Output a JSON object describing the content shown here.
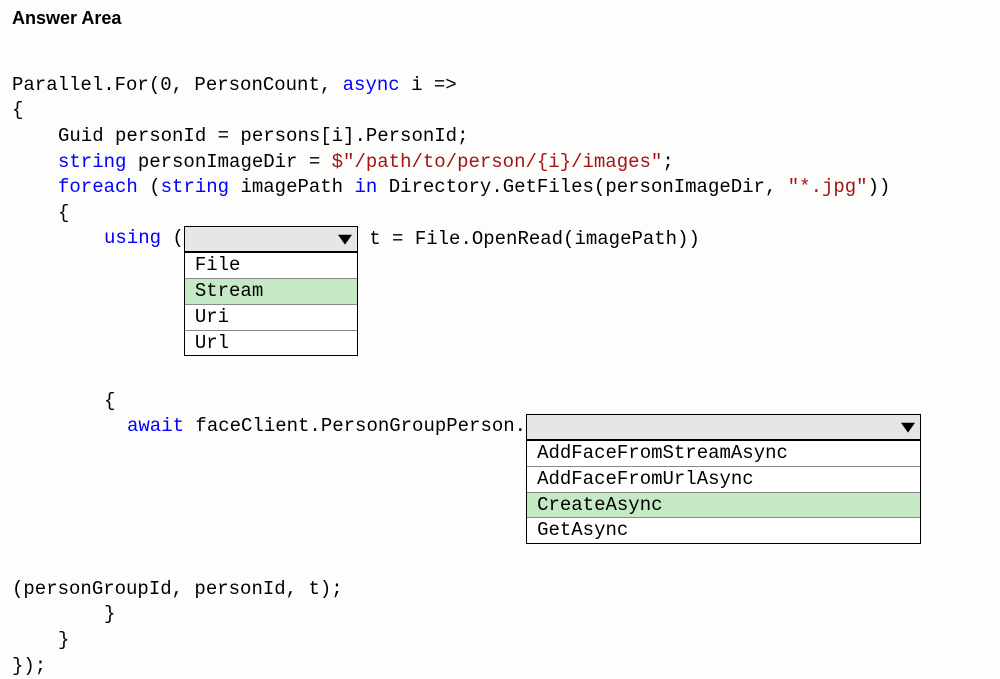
{
  "heading": "Answer Area",
  "code": {
    "line1_a": "Parallel.For(0, PersonCount, ",
    "line1_kw": "async",
    "line1_b": " i =>",
    "line2": "{",
    "line3_a": "Guid personId = persons[i].PersonId;",
    "line4_kw": "string",
    "line4_a": " personImageDir = ",
    "line4_str": "$\"/path/to/person/{i}/images\"",
    "line4_b": ";",
    "line5_kw1": "foreach",
    "line5_a": " (",
    "line5_kw2": "string",
    "line5_b": " imagePath ",
    "line5_kw3": "in",
    "line5_c": " Directory.GetFiles(personImageDir, ",
    "line5_str": "\"*.jpg\"",
    "line5_d": "))",
    "line6": "{",
    "line7_kw": "using",
    "line7_a": " (",
    "line7_after": " t = File.OpenRead(imagePath))",
    "line8": "{",
    "line9_kw": "await",
    "line9_a": " faceClient.PersonGroupPerson.",
    "line10": "(personGroupId, personId, t);",
    "line11": "}",
    "line12": "}",
    "line13": "});"
  },
  "dropdown1": {
    "options": [
      "File",
      "Stream",
      "Uri",
      "Url"
    ],
    "selected_index": 1
  },
  "dropdown2": {
    "options": [
      "AddFaceFromStreamAsync",
      "AddFaceFromUrlAsync",
      "CreateAsync",
      "GetAsync"
    ],
    "selected_index": 2
  }
}
